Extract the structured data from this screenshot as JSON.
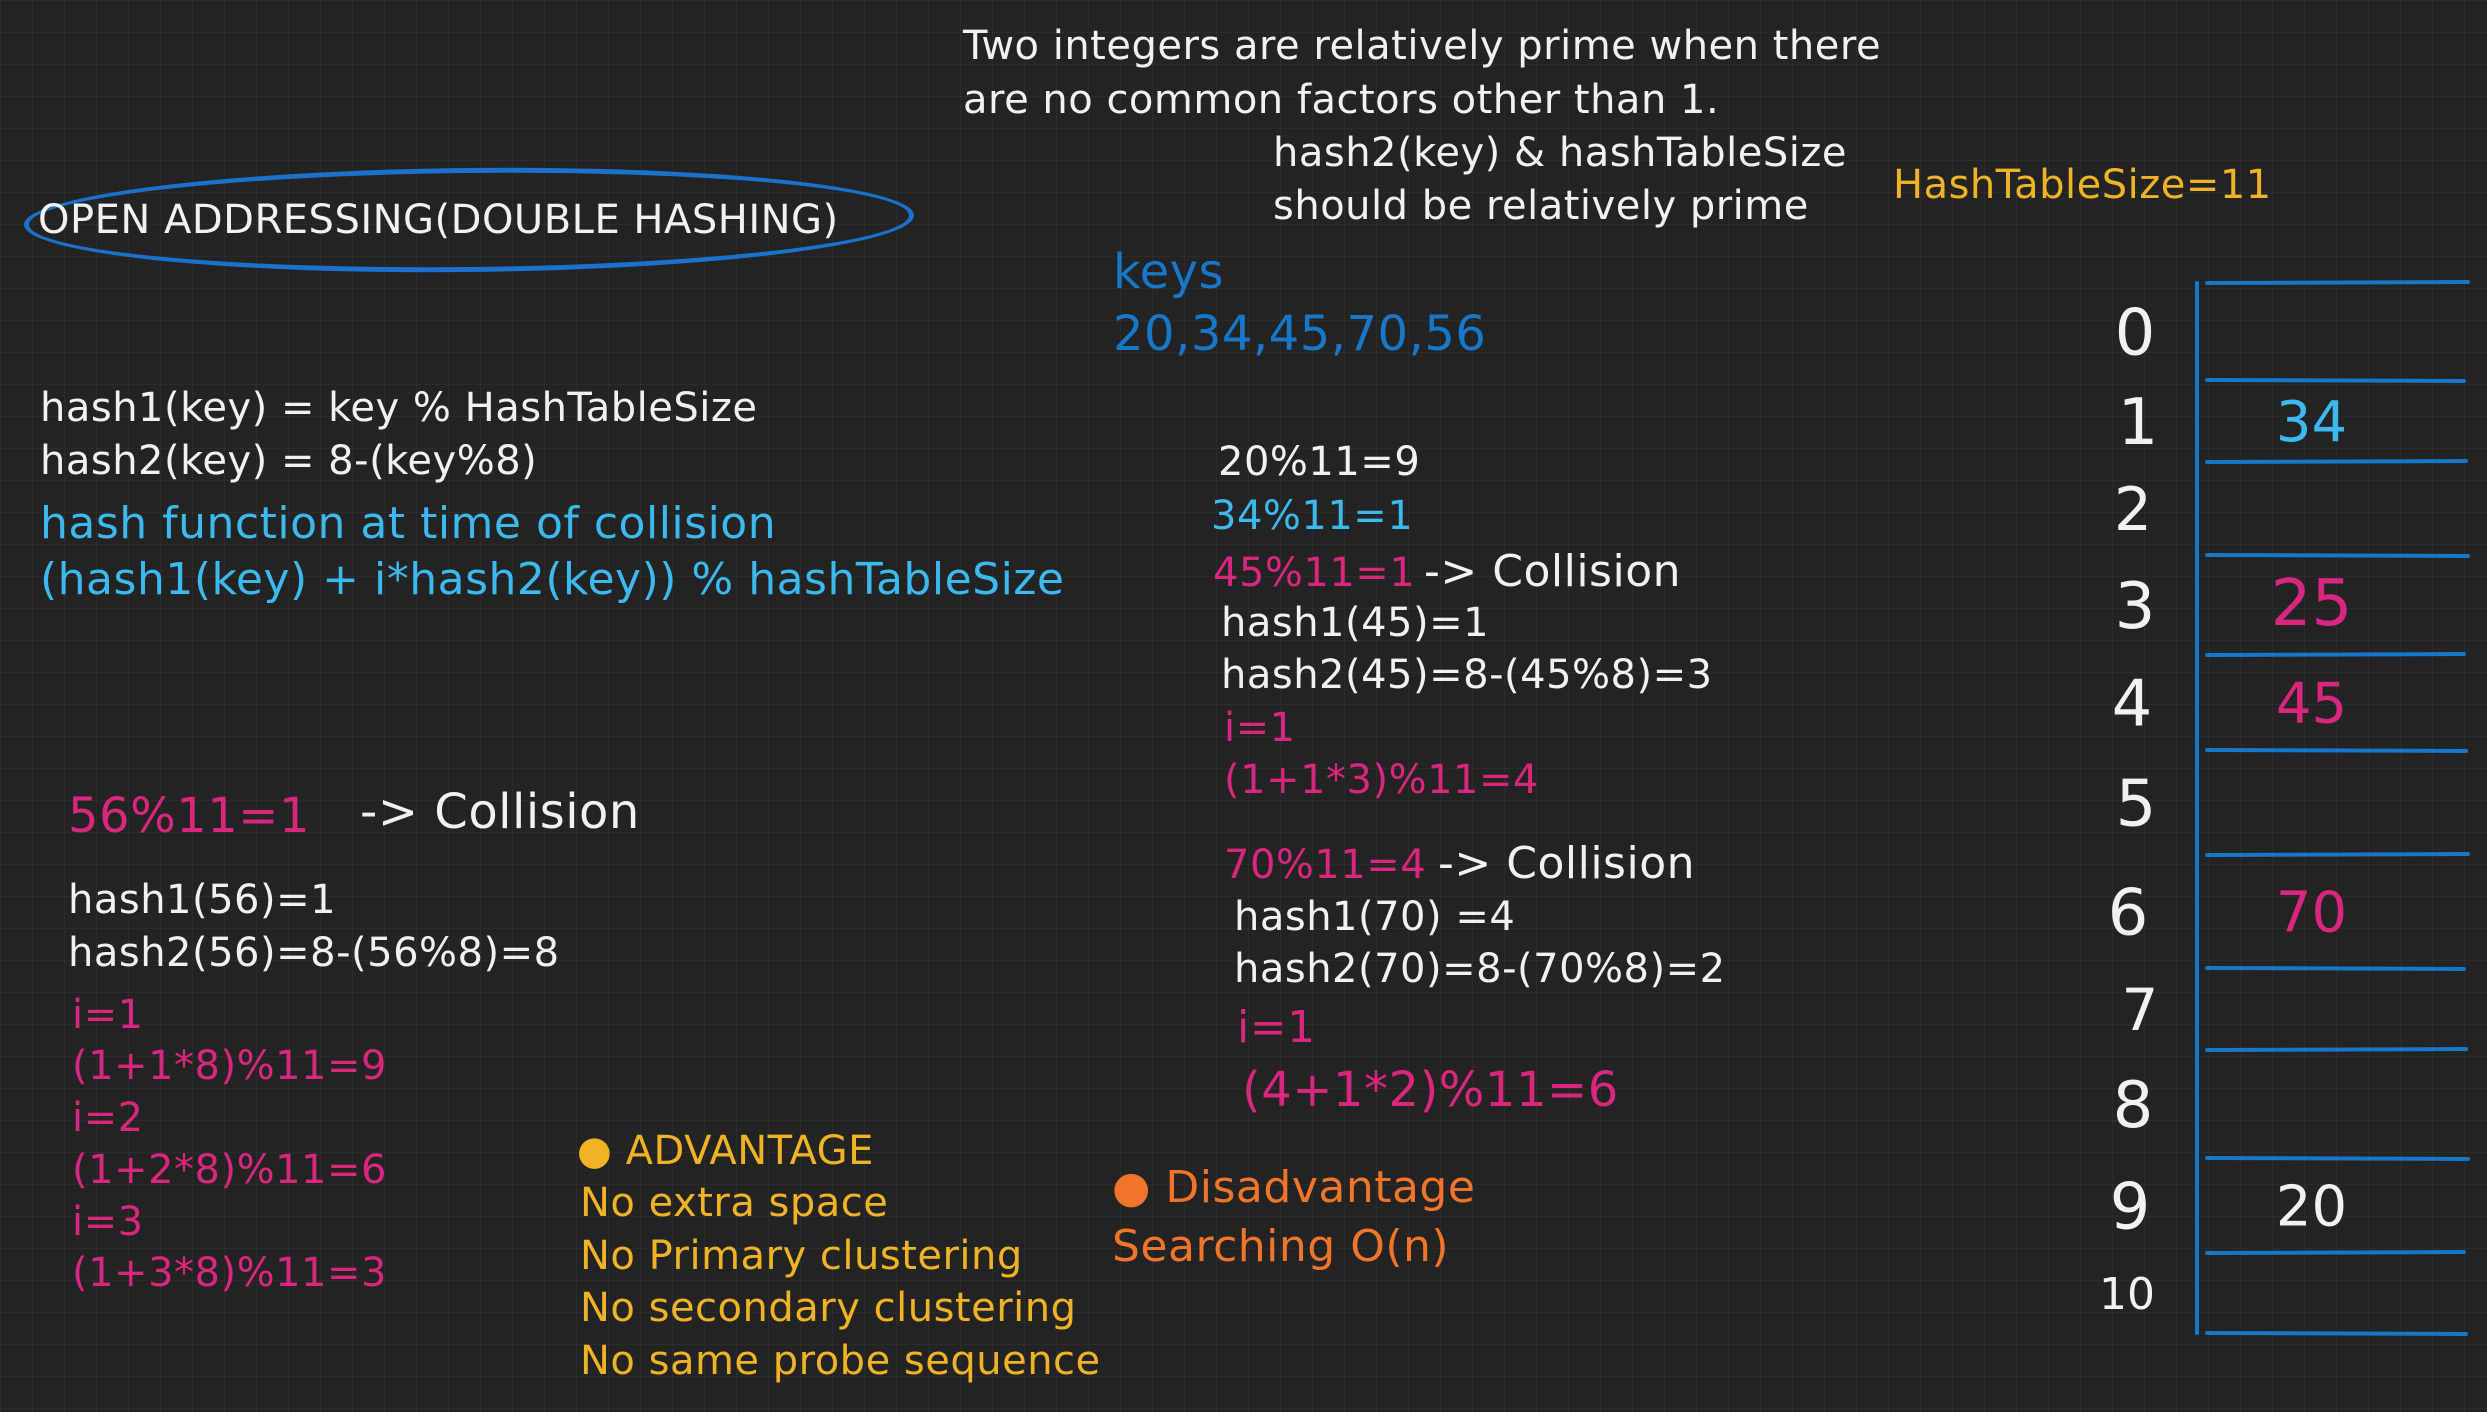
{
  "intro": {
    "line1": "Two integers are relatively prime when there",
    "line2": "are no common factors other than 1.",
    "line3": "hash2(key) & hashTableSize",
    "line4": "should be relatively prime"
  },
  "title": "OPEN ADDRESSING(DOUBLE HASHING)",
  "table_size_label": "HashTableSize=11",
  "keys": {
    "label": "keys",
    "values": "20,34,45,70,56"
  },
  "formulas": {
    "hash1": "hash1(key) = key % HashTableSize",
    "hash2": "hash2(key) = 8-(key%8)",
    "collision_label": "hash function at time of collision",
    "collision_formula": "(hash1(key) + i*hash2(key)) % hashTableSize"
  },
  "steps_middle": {
    "s20": "20%11=9",
    "s34": "34%11=1",
    "s45": "45%11=1",
    "arrow45": "-> Collision",
    "h1_45": "hash1(45)=1",
    "h2_45": "hash2(45)=8-(45%8)=3",
    "i45": "i=1",
    "r45": "(1+1*3)%11=4",
    "s70": "70%11=4",
    "arrow70": "-> Collision",
    "h1_70": "hash1(70) =4",
    "h2_70": "hash2(70)=8-(70%8)=2",
    "i70": "i=1",
    "r70": "(4+1*2)%11=6"
  },
  "steps_left": {
    "s56": "56%11=1",
    "arrow56": "-> Collision",
    "h1_56": "hash1(56)=1",
    "h2_56": "hash2(56)=8-(56%8)=8",
    "i1": "i=1",
    "r1": "(1+1*8)%11=9",
    "i2": "i=2",
    "r2": "(1+2*8)%11=6",
    "i3": "i=3",
    "r3": "(1+3*8)%11=3"
  },
  "advantage": {
    "heading": "ADVANTAGE",
    "items": [
      "No extra  space",
      "No Primary clustering",
      "No secondary clustering",
      "No same probe sequence"
    ]
  },
  "disadvantage": {
    "heading": "Disadvantage",
    "item": "Searching O(n)"
  },
  "hash_table": {
    "indices": [
      "0",
      "1",
      "2",
      "3",
      "4",
      "5",
      "6",
      "7",
      "8",
      "9",
      "10"
    ],
    "slots": [
      {
        "index": "0",
        "value": "",
        "color": ""
      },
      {
        "index": "1",
        "value": "34",
        "color": "#3cb9ee"
      },
      {
        "index": "2",
        "value": "",
        "color": ""
      },
      {
        "index": "3",
        "value": "25",
        "color": "#d9267e"
      },
      {
        "index": "4",
        "value": "45",
        "color": "#d9267e"
      },
      {
        "index": "5",
        "value": "",
        "color": ""
      },
      {
        "index": "6",
        "value": "70",
        "color": "#d9267e"
      },
      {
        "index": "7",
        "value": "",
        "color": ""
      },
      {
        "index": "8",
        "value": "",
        "color": ""
      },
      {
        "index": "9",
        "value": "20",
        "color": "#f1f1f1"
      },
      {
        "index": "10",
        "value": "",
        "color": ""
      }
    ]
  },
  "colors": {
    "background": "#232323",
    "white": "#f1f1f1",
    "cyan": "#3cb9ee",
    "blue": "#1777c9",
    "magenta": "#d9267e",
    "yellow": "#f0b325",
    "orange": "#f0752b"
  }
}
